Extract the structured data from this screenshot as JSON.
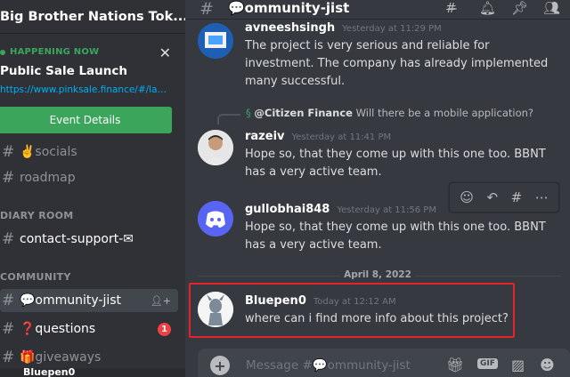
{
  "server": {
    "name": "Big Brother Nations Tok..."
  },
  "event": {
    "status": "HAPPENING NOW",
    "title": "Public Sale Launch",
    "link": "https://www.pinksale.finance/#/lau...",
    "button": "Event Details"
  },
  "channels": {
    "socials": "✌️socials",
    "roadmap": "roadmap",
    "category_diary": "DIARY ROOM",
    "contact": "contact-support-✉",
    "category_community": "COMMUNITY",
    "community_jist": "💬ommunity-jist",
    "questions": "❓questions",
    "questions_badge": "1",
    "giveaways": "🎁giveaways"
  },
  "current_user": {
    "name": "Bluepen0"
  },
  "header": {
    "channel": "💬ommunity-jist"
  },
  "messages": [
    {
      "user": "avneeshsingh",
      "time": "Yesterday at 11:29 PM",
      "text": "The project is very serious and reliable for investment. The company has already implemented many successful."
    },
    {
      "reply_user": "@Citizen Finance",
      "reply_text": "Will there be a mobile application?",
      "user": "razeiv",
      "time": "Yesterday at 11:41 PM",
      "text": "Hope so, that they come up with this one too. BBNT has a very active team."
    },
    {
      "user": "gullobhai848",
      "time": "Yesterday at 11:56 PM",
      "text": "Hope so, that they come up with this one too. BBNT has a very active team."
    },
    {
      "user": "Bluepen0",
      "time": "Today at 12:12 AM",
      "text": "where can i find more info about this project?"
    }
  ],
  "date_divider": "April 8, 2022",
  "composer": {
    "placeholder": "Message #💬ommunity-jist",
    "gif_label": "GIF"
  },
  "colors": {
    "accent_green": "#3ba55c",
    "highlight_red": "#e3242b",
    "link_blue": "#00aff4",
    "badge_red": "#ed4245"
  }
}
